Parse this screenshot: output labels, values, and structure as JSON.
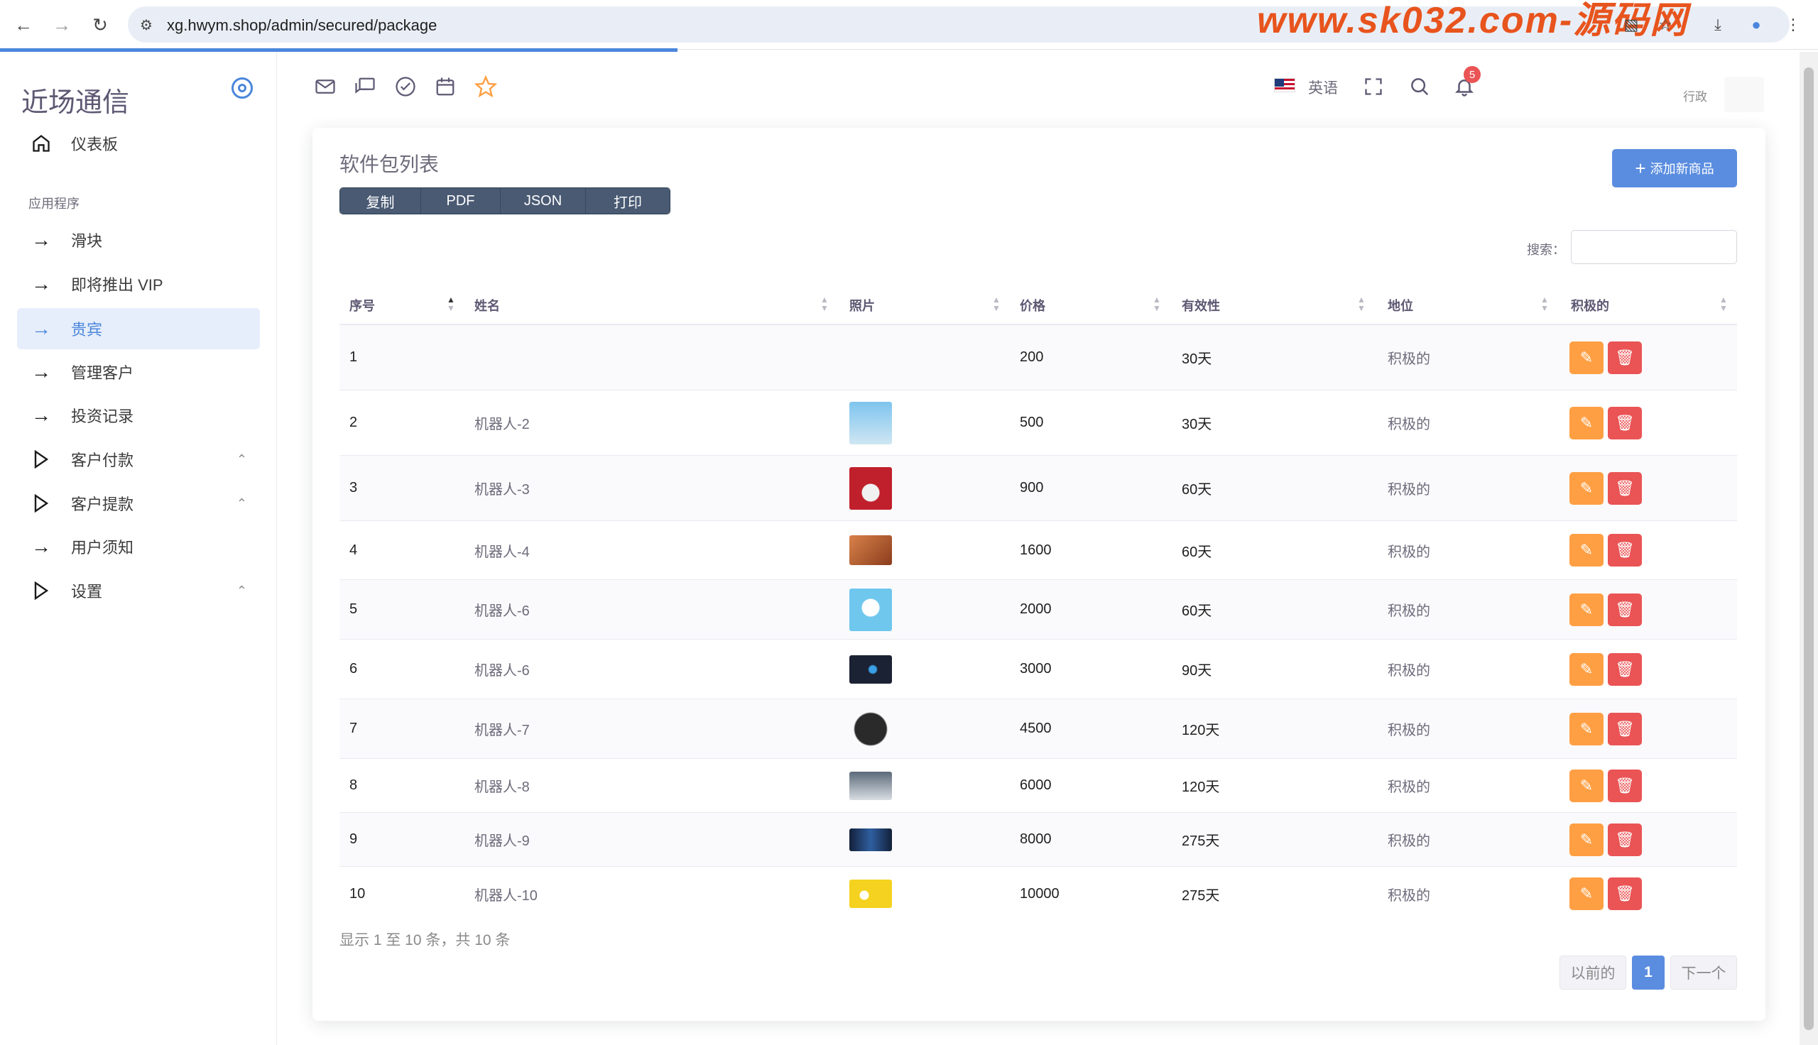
{
  "browser": {
    "url": "xg.hwym.shop/admin/secured/package",
    "watermark": "www.sk032.com-源码网"
  },
  "sidebar": {
    "brand": "近场通信",
    "section_label": "应用程序",
    "items": [
      {
        "label": "仪表板",
        "icon": "home-icon"
      },
      {
        "label": "滑块",
        "icon": "arrow-right-icon"
      },
      {
        "label": "即将推出 VIP",
        "icon": "arrow-right-icon"
      },
      {
        "label": "贵宾",
        "icon": "arrow-right-icon",
        "active": true
      },
      {
        "label": "管理客户",
        "icon": "arrow-right-icon"
      },
      {
        "label": "投资记录",
        "icon": "arrow-right-icon"
      },
      {
        "label": "客户付款",
        "icon": "play-icon",
        "expandable": true
      },
      {
        "label": "客户提款",
        "icon": "play-icon",
        "expandable": true
      },
      {
        "label": "用户须知",
        "icon": "arrow-right-icon"
      },
      {
        "label": "设置",
        "icon": "play-icon",
        "expandable": true
      }
    ]
  },
  "header": {
    "language": "英语",
    "notification_count": "5",
    "user_role": "行政"
  },
  "card": {
    "title": "软件包列表",
    "export_buttons": [
      "复制",
      "PDF",
      "JSON",
      "打印"
    ],
    "add_button": "添加新商品",
    "search_label": "搜索：",
    "search_value": ""
  },
  "table": {
    "columns": [
      "序号",
      "姓名",
      "照片",
      "价格",
      "有效性",
      "地位",
      "积极的"
    ],
    "rows": [
      {
        "id": "1",
        "name": "",
        "photo": "",
        "price": "200",
        "validity": "30天",
        "status": "积极的"
      },
      {
        "id": "2",
        "name": "机器人-2",
        "photo": "robot-thumb-light-blue",
        "price": "500",
        "validity": "30天",
        "status": "积极的"
      },
      {
        "id": "3",
        "name": "机器人-3",
        "photo": "robot-thumb-red",
        "price": "900",
        "validity": "60天",
        "status": "积极的"
      },
      {
        "id": "4",
        "name": "机器人-4",
        "photo": "robot-thumb-orange",
        "price": "1600",
        "validity": "60天",
        "status": "积极的"
      },
      {
        "id": "5",
        "name": "机器人-6",
        "photo": "robot-thumb-sky",
        "price": "2000",
        "validity": "60天",
        "status": "积极的"
      },
      {
        "id": "6",
        "name": "机器人-6",
        "photo": "robot-thumb-dark",
        "price": "3000",
        "validity": "90天",
        "status": "积极的"
      },
      {
        "id": "7",
        "name": "机器人-7",
        "photo": "robot-thumb-round",
        "price": "4500",
        "validity": "120天",
        "status": "积极的"
      },
      {
        "id": "8",
        "name": "机器人-8",
        "photo": "robot-thumb-street",
        "price": "6000",
        "validity": "120天",
        "status": "积极的"
      },
      {
        "id": "9",
        "name": "机器人-9",
        "photo": "robot-thumb-city",
        "price": "8000",
        "validity": "275天",
        "status": "积极的"
      },
      {
        "id": "10",
        "name": "机器人-10",
        "photo": "robot-thumb-yellow",
        "price": "10000",
        "validity": "275天",
        "status": "积极的"
      }
    ],
    "info": "显示 1 至 10 条，共 10 条",
    "pagination": {
      "prev": "以前的",
      "current": "1",
      "next": "下一个"
    }
  },
  "colors": {
    "primary": "#5a8de0",
    "edit": "#ff9f43",
    "delete": "#ea5455",
    "export_buttons": "#4a5a73"
  }
}
